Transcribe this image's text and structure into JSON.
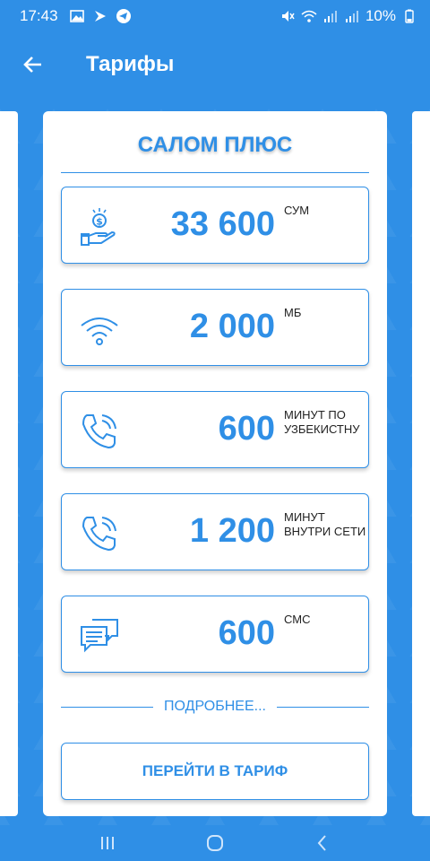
{
  "status_bar": {
    "time": "17:43",
    "battery": "10%"
  },
  "app_bar": {
    "title": "Тарифы"
  },
  "plan": {
    "name": "САЛОМ ПЛЮС",
    "features": [
      {
        "icon": "money-hand-icon",
        "value": "33 600",
        "unit": "СУМ"
      },
      {
        "icon": "wifi-icon",
        "value": "2 000",
        "unit": "МБ"
      },
      {
        "icon": "phone-icon",
        "value": "600",
        "unit": "МИНУТ ПО УЗБЕКИСТНУ"
      },
      {
        "icon": "phone-icon",
        "value": "1 200",
        "unit": "МИНУТ ВНУТРИ СЕТИ"
      },
      {
        "icon": "sms-icon",
        "value": "600",
        "unit": "СМС"
      }
    ],
    "more_label": "ПОДРОБНЕЕ...",
    "go_button_label": "ПЕРЕЙТИ В ТАРИФ"
  },
  "colors": {
    "primary": "#2f8fe6",
    "card": "#ffffff",
    "text_dark": "#222222"
  }
}
